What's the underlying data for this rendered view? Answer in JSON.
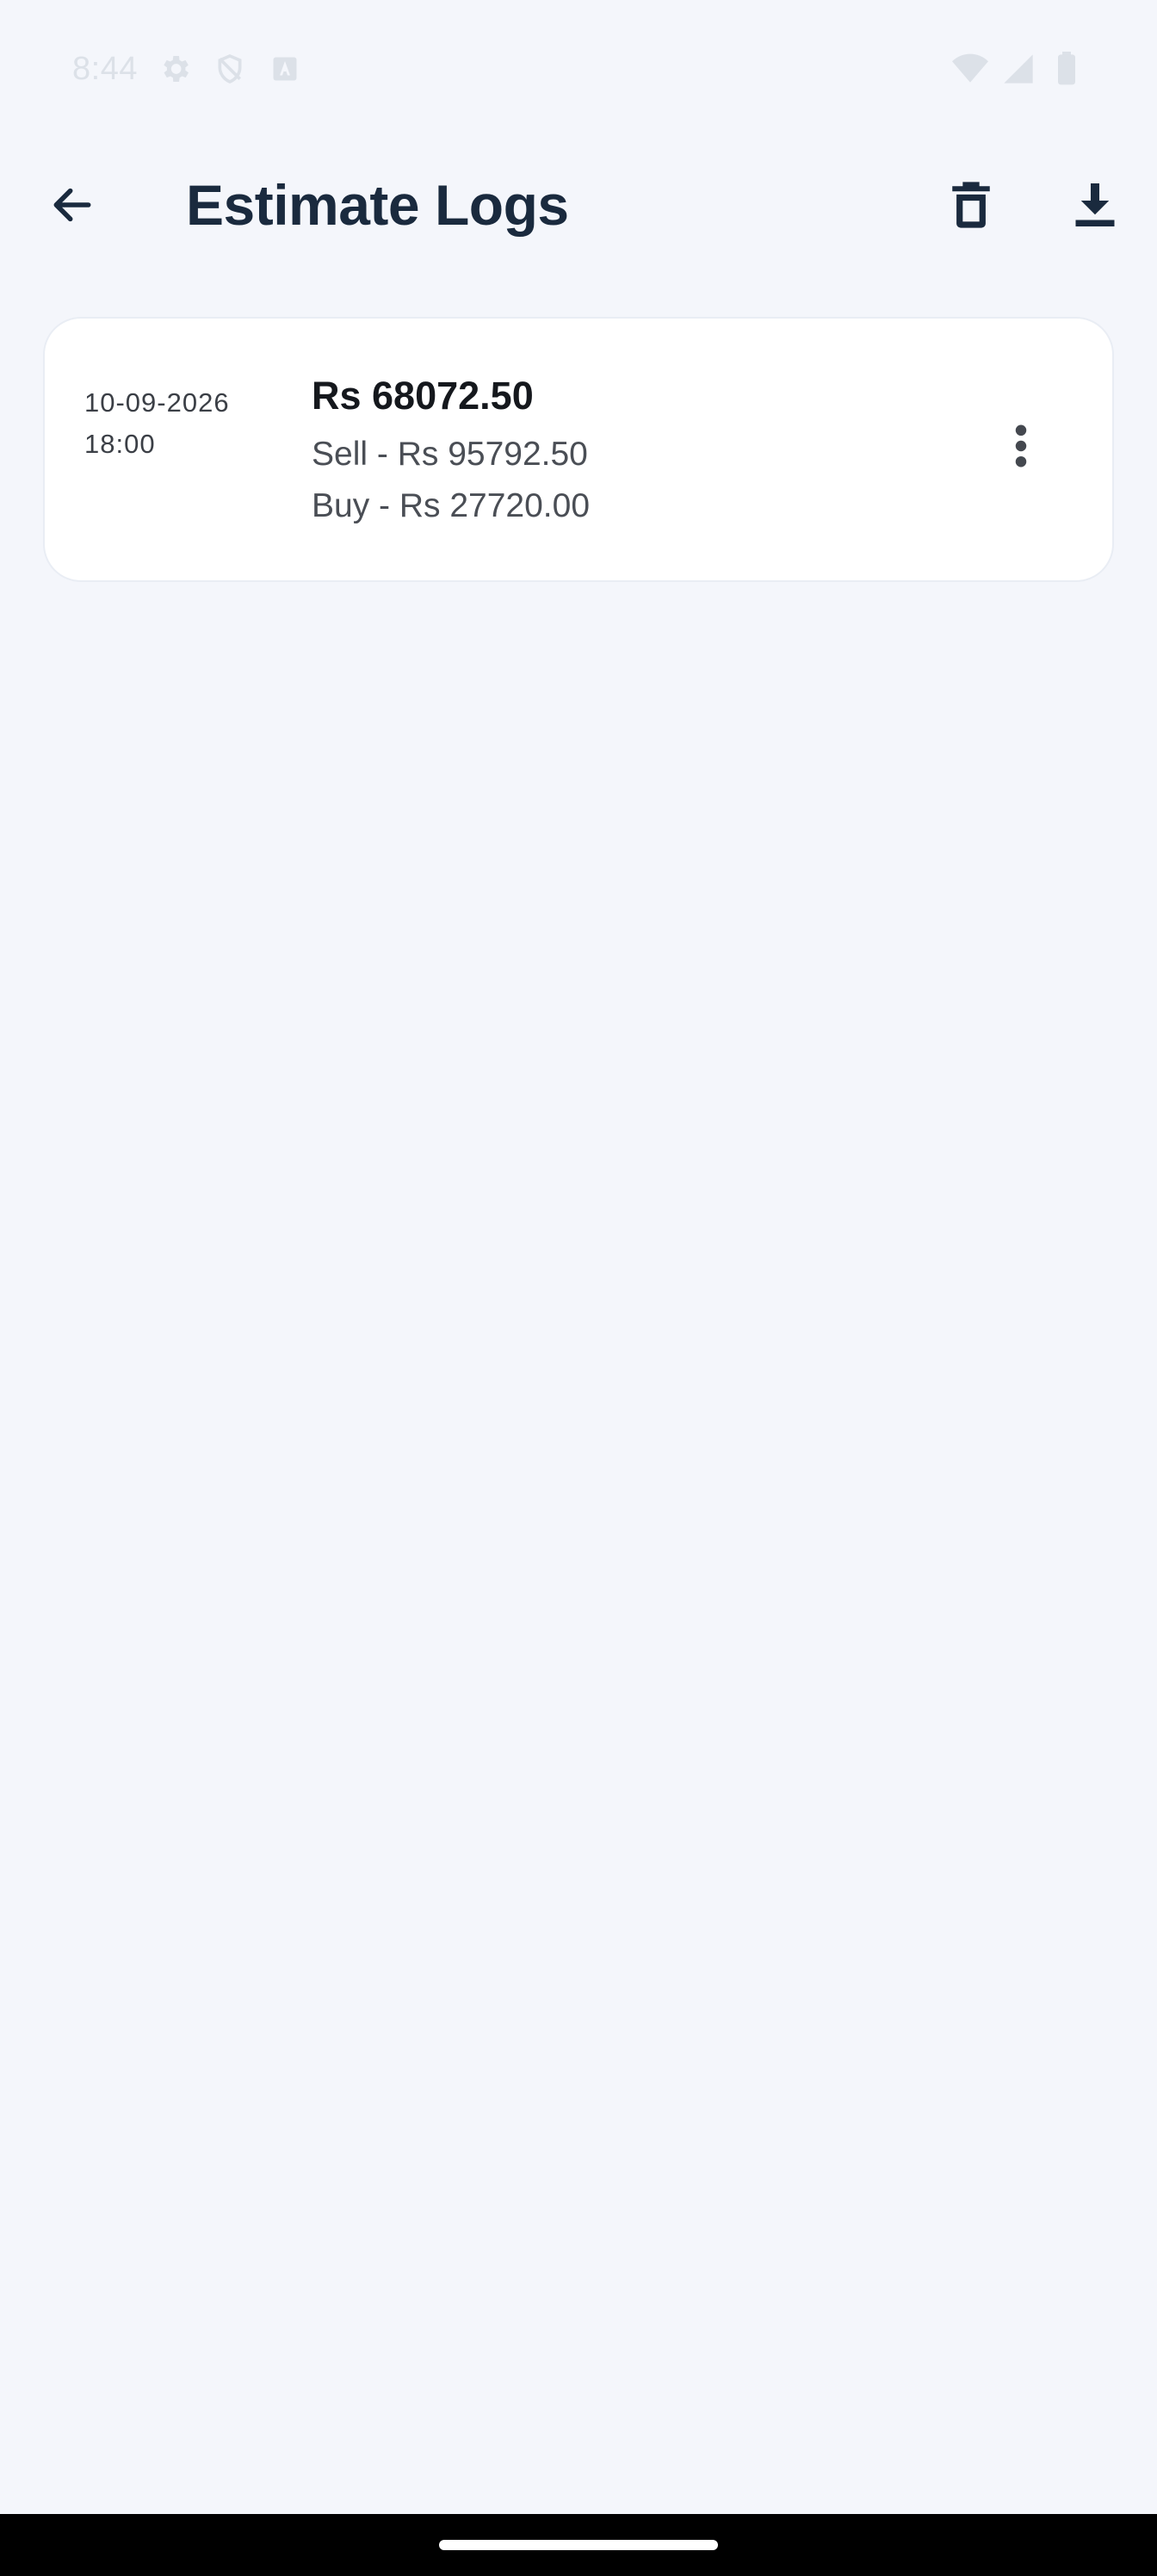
{
  "status_bar": {
    "time": "8:44",
    "icons": [
      "settings-icon",
      "shield-icon",
      "keyboard-icon",
      "wifi-icon",
      "signal-icon",
      "battery-icon"
    ]
  },
  "app_bar": {
    "title": "Estimate Logs",
    "actions": [
      "back-arrow-icon",
      "delete-icon",
      "download-icon"
    ]
  },
  "logs": [
    {
      "date": "10-09-2026",
      "time": "18:00",
      "amount": "Rs 68072.50",
      "sell": "Sell - Rs 95792.50",
      "buy": "Buy - Rs 27720.00"
    }
  ],
  "colors": {
    "background": "#f4f6fb",
    "title": "#1a2a3e",
    "card": "#ffffff"
  }
}
